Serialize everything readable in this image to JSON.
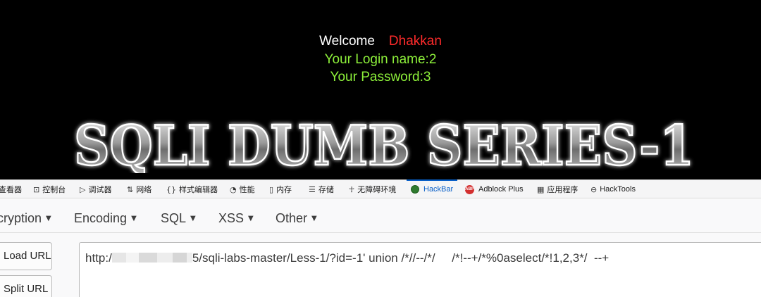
{
  "page": {
    "welcome_word": "Welcome",
    "welcome_name": "Dhakkan",
    "login_line": "Your Login name:2",
    "password_line": "Your Password:3",
    "banner_text": "SQLI DUMB SERIES-1"
  },
  "devtools": {
    "tabs": [
      {
        "label": "查看器",
        "icon": "inspector-icon"
      },
      {
        "label": "控制台",
        "icon": "console-icon"
      },
      {
        "label": "调试器",
        "icon": "debugger-icon"
      },
      {
        "label": "网络",
        "icon": "network-icon"
      },
      {
        "label": "样式编辑器",
        "icon": "braces-icon"
      },
      {
        "label": "性能",
        "icon": "performance-icon"
      },
      {
        "label": "内存",
        "icon": "memory-icon"
      },
      {
        "label": "存储",
        "icon": "storage-icon"
      },
      {
        "label": "无障碍环境",
        "icon": "accessibility-icon"
      },
      {
        "label": "HackBar",
        "icon": "hackbar-icon",
        "active": true
      },
      {
        "label": "Adblock Plus",
        "icon": "abp-icon"
      },
      {
        "label": "应用程序",
        "icon": "grid-icon"
      },
      {
        "label": "HackTools",
        "icon": "hacktools-icon"
      }
    ],
    "accent": "#0a60c8"
  },
  "hackbar": {
    "menu": [
      "cryption",
      "Encoding",
      "SQL",
      "XSS",
      "Other"
    ],
    "load_url": "Load URL",
    "split_url": "Split URL",
    "url_prefix": "http:/",
    "url_rest": "5/sqli-labs-master/Less-1/?id=-1' union /*//--/*/     /*!--+/*%0aselect/*!1,2,3*/  --+"
  }
}
